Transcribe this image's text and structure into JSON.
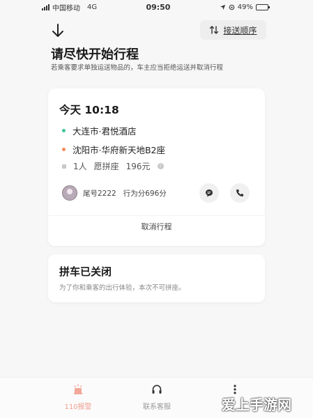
{
  "status_bar": {
    "carrier": "中国移动",
    "network": "4G",
    "time": "09:50",
    "battery": "49%",
    "battery_level": 0.49
  },
  "header": {
    "order_button_label": "接送顺序",
    "title": "请尽快开始行程",
    "subtitle": "若乘客要求单独运送物品的，车主应当拒绝运送并取消行程"
  },
  "trip_card": {
    "time": "今天 10:18",
    "pickup": "大连市·君悦酒店",
    "dropoff": "沈阳市·华府新天地B2座",
    "seats": "1人",
    "ride_type": "愿拼座",
    "price": "196元",
    "driver": {
      "name": "尾号2222",
      "score": "行为分696分"
    },
    "cancel_label": "取消行程",
    "colors": {
      "pickup_dot": "#3cc49a",
      "dropoff_dot": "#f58a5a"
    }
  },
  "carpool_card": {
    "title": "拼车已关闭",
    "description": "为了你和乘客的出行体验，本次不可拼座。"
  },
  "bottom_bar": {
    "tabs": [
      {
        "label": "110报警",
        "icon": "alarm-icon"
      },
      {
        "label": "联系客服",
        "icon": "headset-icon"
      },
      {
        "label": "",
        "icon": "more-vertical-icon"
      }
    ]
  },
  "watermark": "爱上手游网"
}
